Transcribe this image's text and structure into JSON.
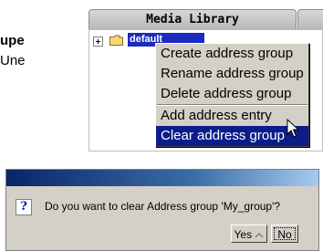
{
  "background": {
    "title_fragment": "upe",
    "subtitle_fragment": "Une"
  },
  "panel": {
    "tab_title": "Media Library",
    "tree_item_label": "default"
  },
  "context_menu": {
    "items": [
      {
        "label": "Create address group"
      },
      {
        "label": "Rename address group"
      },
      {
        "label": "Delete address group"
      },
      {
        "label": "Add address entry"
      },
      {
        "label": "Clear address group",
        "selected": true
      }
    ]
  },
  "dialog": {
    "icon_glyph": "?",
    "message": "Do you want to clear Address group  'My_group'?",
    "yes_label": "Yes",
    "no_label": "No"
  },
  "colors": {
    "menu_highlight": "#0b1d8a",
    "titlebar_start": "#0a246a",
    "titlebar_end": "#a6caf0",
    "window_face": "#d4d0c8"
  }
}
